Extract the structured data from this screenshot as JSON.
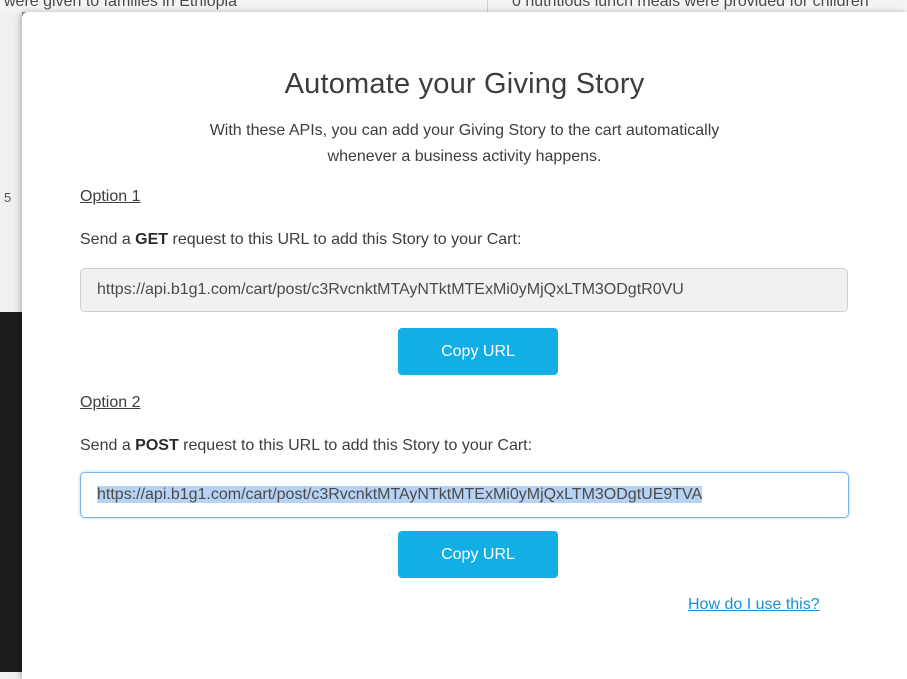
{
  "background": {
    "left_text": "were given to families in Ethiopia",
    "right_text": "0 nutritious lunch meals were provided for children",
    "side_number": "5"
  },
  "modal": {
    "title": "Automate your Giving Story",
    "subtitle": "With these APIs, you can add your Giving Story to the cart automatically whenever a business activity happens.",
    "option1": {
      "heading": "Option 1",
      "prefix": "Send a ",
      "method": "GET",
      "suffix": " request to this URL to add this Story to your Cart:",
      "url": "https://api.b1g1.com/cart/post/c3RvcnktMTAyNTktMTExMi0yMjQxLTM3ODgtR0VU",
      "button_label": "Copy URL"
    },
    "option2": {
      "heading": "Option 2",
      "prefix": "Send a ",
      "method": "POST",
      "suffix": " request to this URL to add this Story to your Cart:",
      "url": "https://api.b1g1.com/cart/post/c3RvcnktMTAyNTktMTExMi0yMjQxLTM3ODgtUE9TVA",
      "button_label": "Copy URL"
    },
    "help_link": "How do I use this?"
  },
  "colors": {
    "accent_button": "#14aee7",
    "link": "#1a8fcf",
    "selection": "#b7d3f3"
  }
}
